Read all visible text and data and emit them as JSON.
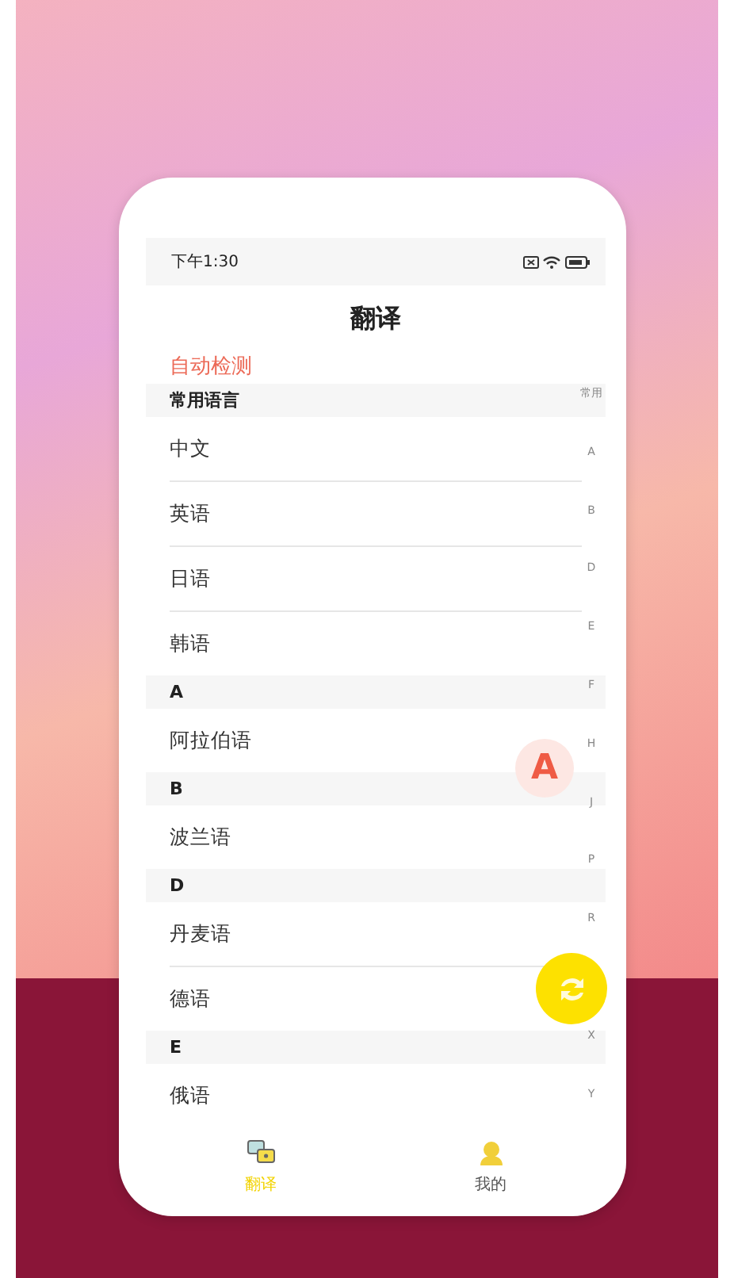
{
  "status_bar": {
    "time": "下午1:30"
  },
  "title": "翻译",
  "auto_detect": "自动检测",
  "sections": [
    {
      "header": "常用语言",
      "items": [
        "中文",
        "英语",
        "日语",
        "韩语"
      ]
    },
    {
      "header": "A",
      "items": [
        "阿拉伯语"
      ]
    },
    {
      "header": "B",
      "items": [
        "波兰语"
      ]
    },
    {
      "header": "D",
      "items": [
        "丹麦语",
        "德语"
      ]
    },
    {
      "header": "E",
      "items": [
        "俄语"
      ]
    }
  ],
  "index_bar": [
    "常用",
    "A",
    "B",
    "D",
    "E",
    "F",
    "H",
    "J",
    "P",
    "R",
    "X",
    "Y"
  ],
  "letter_bubble": "A",
  "tabs": [
    {
      "label": "翻译",
      "kind": "translate",
      "selected": true
    },
    {
      "label": "我的",
      "kind": "profile",
      "selected": false
    }
  ]
}
